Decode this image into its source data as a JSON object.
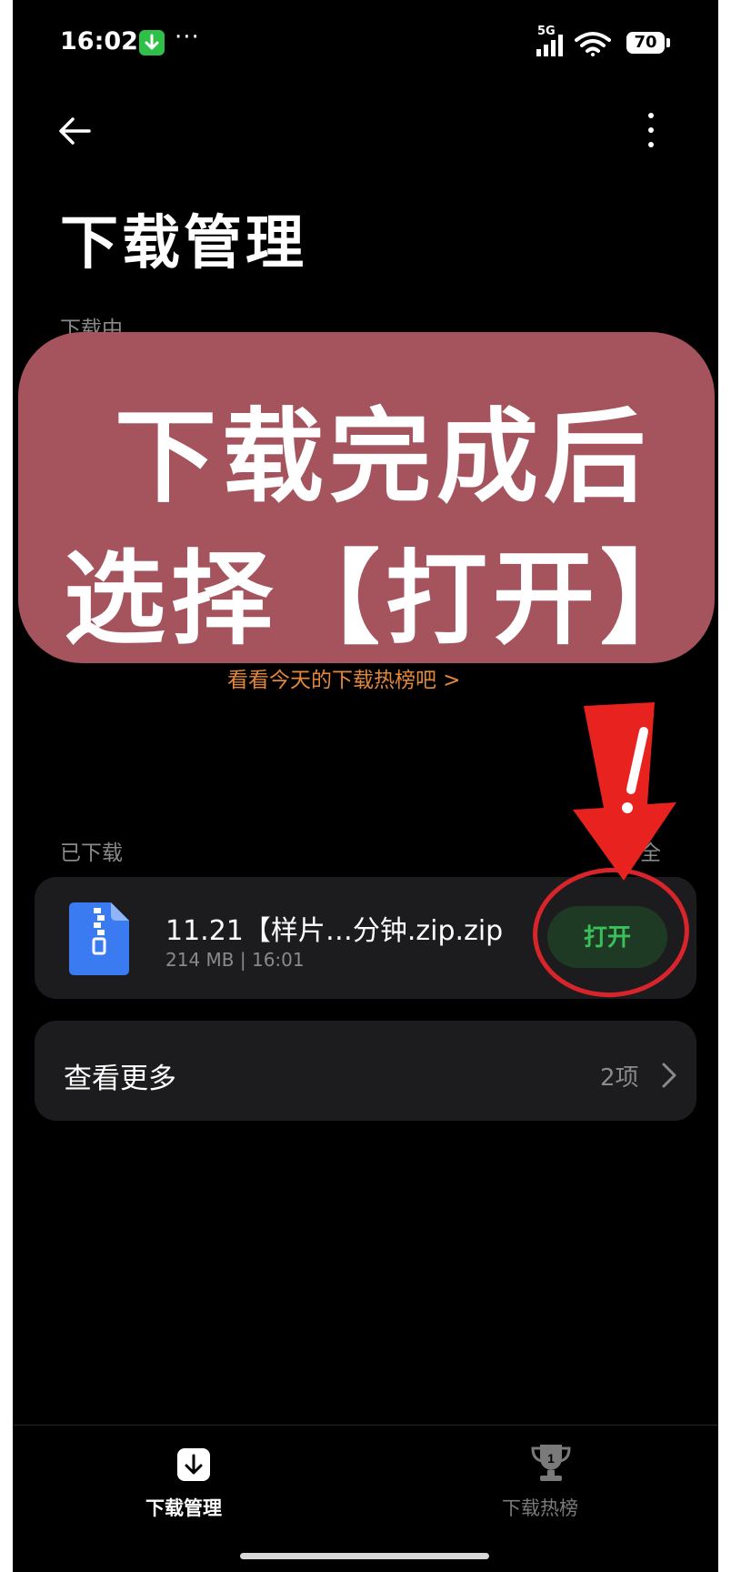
{
  "status_bar": {
    "time": "16:02",
    "network": "5G",
    "battery": "70"
  },
  "header": {
    "title": "下载管理"
  },
  "sections": {
    "downloading_label": "下载中",
    "downloaded_label": "已下载",
    "clear_all_label": "全"
  },
  "overlay": {
    "line1": "下载完成后",
    "line2": "选择【打开】",
    "color": "#a5535c"
  },
  "hot_link": "看看今天的下载热榜吧 >",
  "downloaded_items": [
    {
      "name": "11.21【样片…分钟.zip.zip",
      "size": "214 MB",
      "time": "16:01",
      "action_label": "打开"
    }
  ],
  "see_more": {
    "label": "查看更多",
    "count": "2项"
  },
  "bottom_nav": [
    {
      "label": "下载管理",
      "icon": "download-icon",
      "active": true
    },
    {
      "label": "下载热榜",
      "icon": "trophy-icon",
      "active": false
    }
  ],
  "colors": {
    "background": "#000000",
    "card": "#1c1c1e",
    "accent_green": "#39c05a",
    "link_orange": "#e2873a",
    "annotation_red": "#d8242b"
  }
}
